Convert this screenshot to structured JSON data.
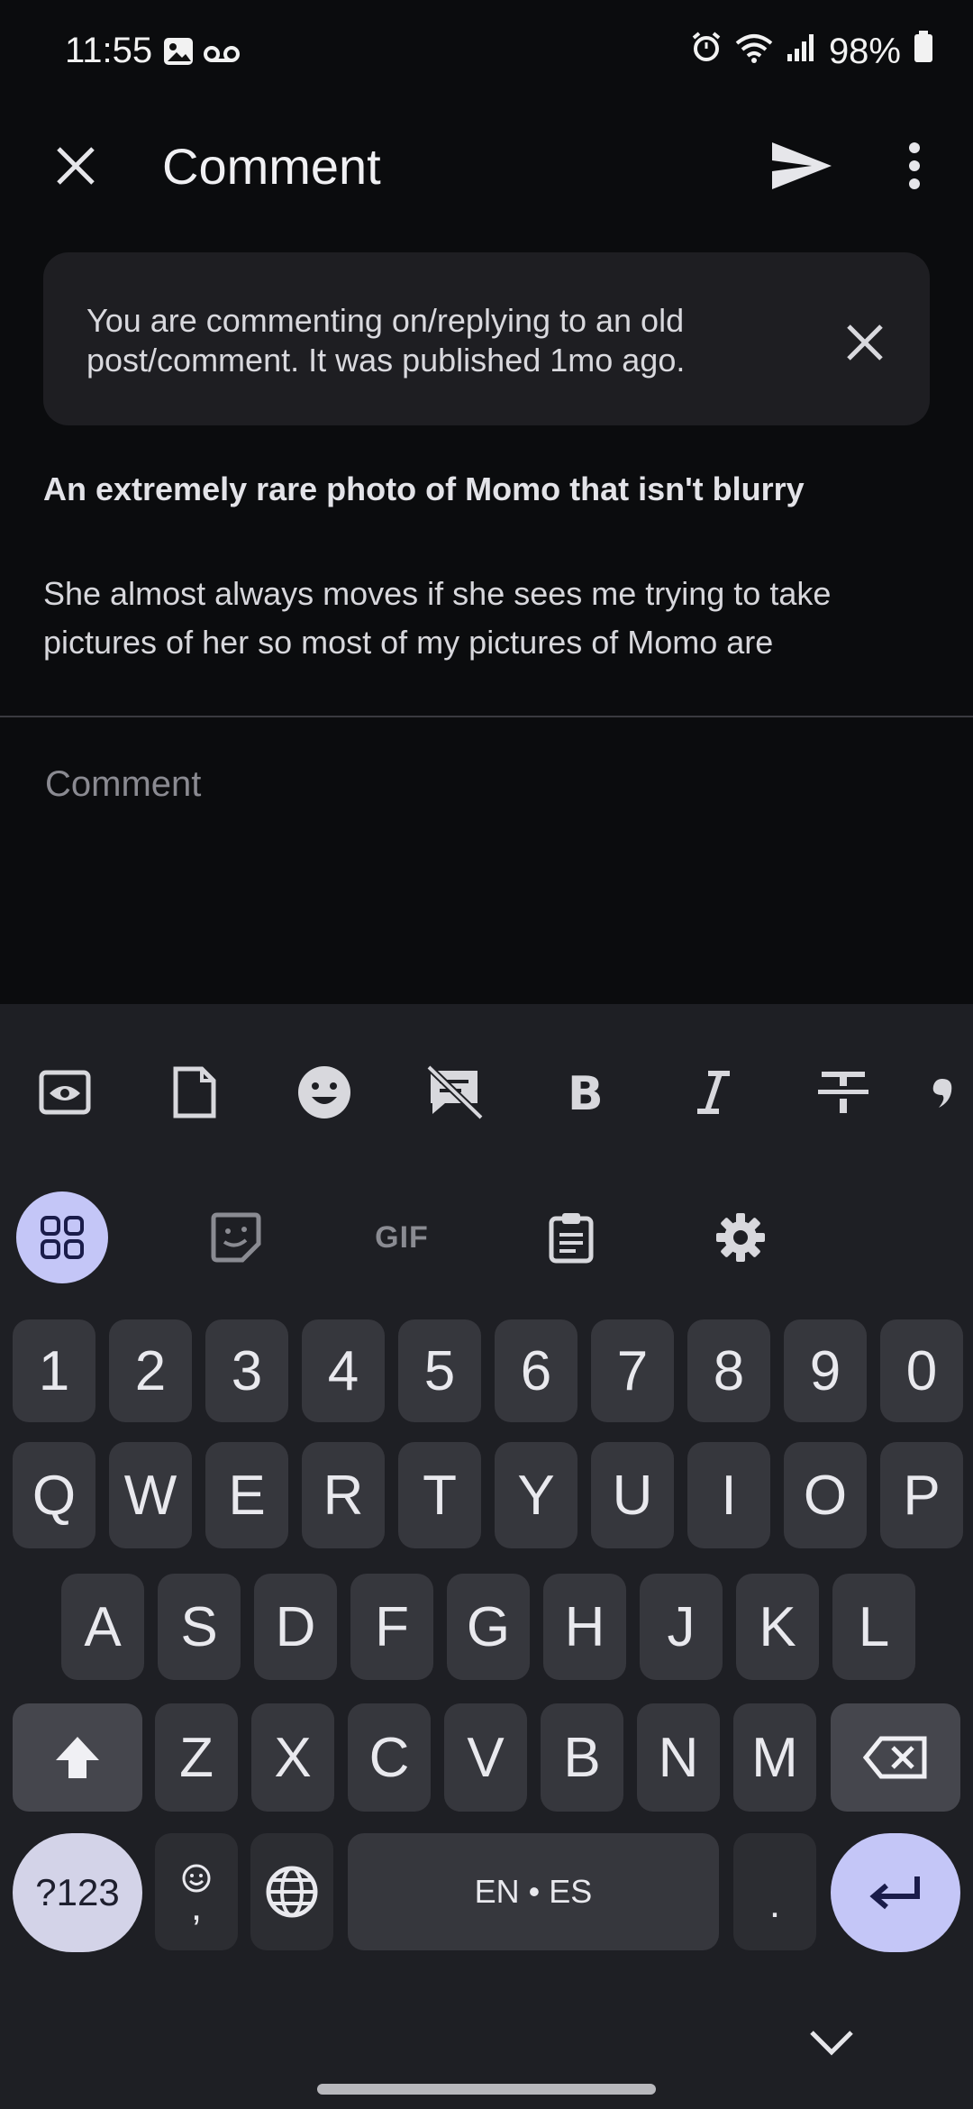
{
  "status": {
    "time": "11:55",
    "battery": "98%"
  },
  "header": {
    "title": "Comment"
  },
  "notice": {
    "text": "You are commenting on/replying to an old post/comment. It was published 1mo ago."
  },
  "post": {
    "title": "An extremely rare photo of Momo that isn't blurry",
    "body": "She almost always moves if she sees me trying to take pictures of her so most of my pictures of Momo are"
  },
  "comment": {
    "placeholder": "Comment"
  },
  "keyboard": {
    "number_row": [
      "1",
      "2",
      "3",
      "4",
      "5",
      "6",
      "7",
      "8",
      "9",
      "0"
    ],
    "row1": [
      "Q",
      "W",
      "E",
      "R",
      "T",
      "Y",
      "U",
      "I",
      "O",
      "P"
    ],
    "row2": [
      "A",
      "S",
      "D",
      "F",
      "G",
      "H",
      "J",
      "K",
      "L"
    ],
    "row3": [
      "Z",
      "X",
      "C",
      "V",
      "B",
      "N",
      "M"
    ],
    "symbols_label": "?123",
    "emoji_comma": ",",
    "space_label": "EN • ES",
    "period": ".",
    "gif_label": "GIF"
  }
}
